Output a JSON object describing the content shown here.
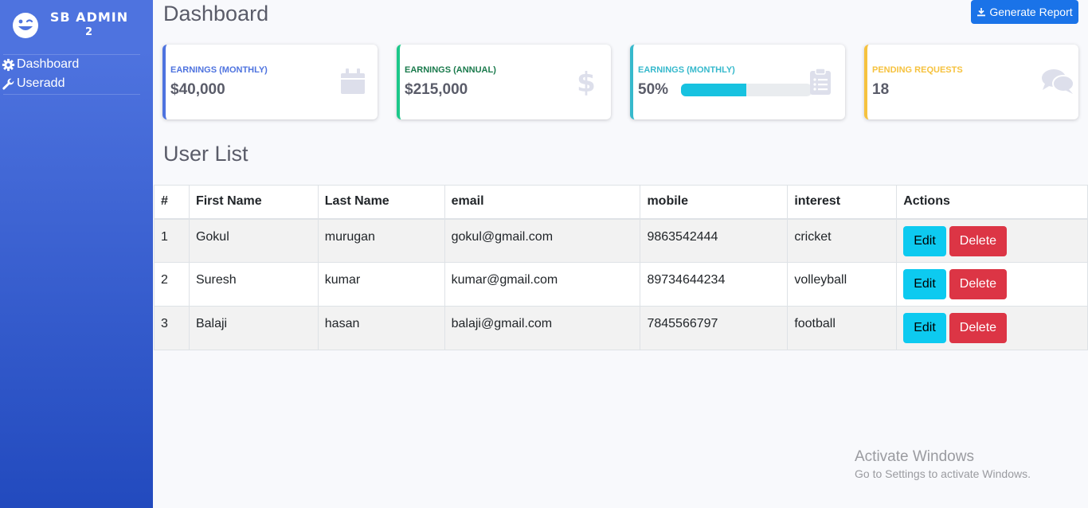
{
  "sidebar": {
    "brand_line1": "SB ADMIN",
    "brand_line2": "2",
    "items": [
      {
        "label": "Dashboard",
        "icon": "gear-icon"
      },
      {
        "label": "Useradd",
        "icon": "wrench-icon"
      }
    ]
  },
  "header": {
    "title": "Dashboard",
    "report_button": "Generate Report",
    "report_icon": "download-icon"
  },
  "cards": [
    {
      "label": "Earnings (Monthly)",
      "value": "$40,000",
      "color": "#4e73df",
      "icon": "calendar-icon"
    },
    {
      "label": "Earnings (Annual)",
      "value": "$215,000",
      "color": "#1cc88a",
      "label_color": "#1a7a4c",
      "icon": "dollar-icon"
    },
    {
      "label": "Earnings (Monthly)",
      "value": "50%",
      "progress": 0.5,
      "color": "#36b9cc",
      "icon": "clipboard-icon"
    },
    {
      "label": "Pending Requests",
      "value": "18",
      "color": "#f6c23e",
      "icon": "comments-icon"
    }
  ],
  "user_list": {
    "title": "User List",
    "columns": [
      "#",
      "First Name",
      "Last Name",
      "email",
      "mobile",
      "interest",
      "Actions"
    ],
    "rows": [
      {
        "id": "1",
        "first": "Gokul",
        "last": "murugan",
        "email": "gokul@gmail.com",
        "mobile": "9863542444",
        "interest": "cricket"
      },
      {
        "id": "2",
        "first": "Suresh",
        "last": "kumar",
        "email": "kumar@gmail.com",
        "mobile": "89734644234",
        "interest": "volleyball"
      },
      {
        "id": "3",
        "first": "Balaji",
        "last": "hasan",
        "email": "balaji@gmail.com",
        "mobile": "7845566797",
        "interest": "football"
      }
    ],
    "edit_label": "Edit",
    "delete_label": "Delete"
  },
  "watermark": {
    "line1": "Activate Windows",
    "line2": "Go to Settings to activate Windows."
  }
}
